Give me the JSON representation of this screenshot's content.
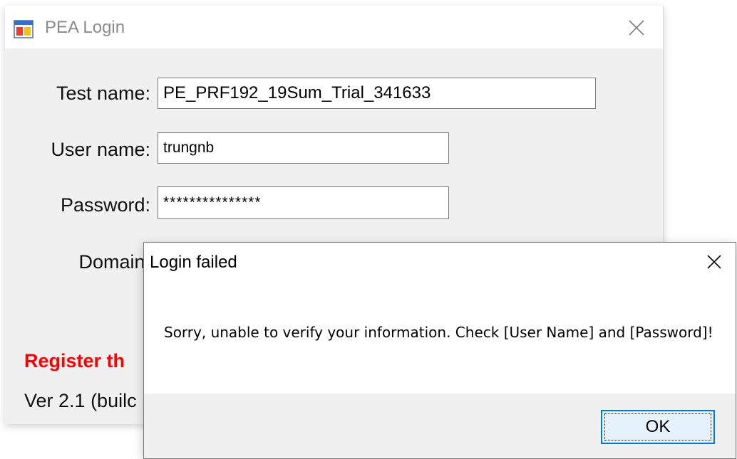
{
  "main_window": {
    "title": "PEA Login",
    "icon": "app-window-icon",
    "close_icon": "close-icon",
    "form": {
      "test_name_label": "Test name:",
      "test_name_value": "PE_PRF192_19Sum_Trial_341633",
      "user_name_label": "User name:",
      "user_name_value": "trungnb",
      "password_label": "Password:",
      "password_value": "***************",
      "domain_label": "Domain:"
    },
    "register_text": "Register th",
    "version_text": "Ver 2.1 (builc"
  },
  "dialog": {
    "title": "Login failed",
    "close_icon": "close-icon",
    "message": "Sorry, unable to verify your information. Check [User Name] and [Password]!",
    "ok_label": "OK"
  },
  "colors": {
    "window_bg": "#f0f0f0",
    "register_red": "#ff0000",
    "button_accent": "#0078d7"
  }
}
